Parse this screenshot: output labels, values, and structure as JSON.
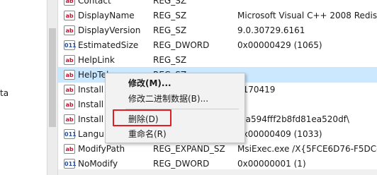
{
  "tree": {
    "partial_label": "ta"
  },
  "rows": [
    {
      "icon": "ab",
      "name": "Contact",
      "type": "REG_SZ",
      "data": ""
    },
    {
      "icon": "ab",
      "name": "DisplayName",
      "type": "REG_SZ",
      "data": "Microsoft Visual C++ 2008 Redis"
    },
    {
      "icon": "ab",
      "name": "DisplayVersion",
      "type": "REG_SZ",
      "data": "9.0.30729.6161"
    },
    {
      "icon": "011",
      "name": "EstimatedSize",
      "type": "REG_DWORD",
      "data": "0x00000429 (1065)"
    },
    {
      "icon": "ab",
      "name": "HelpLink",
      "type": "REG_SZ",
      "data": ""
    },
    {
      "icon": "ab",
      "name": "HelpTele",
      "type": "REG_SZ",
      "data": ""
    },
    {
      "icon": "ab",
      "name": "Install",
      "type": "",
      "data": "0170419"
    },
    {
      "icon": "ab",
      "name": "Install",
      "type": "",
      "data": ""
    },
    {
      "icon": "ab",
      "name": "Install",
      "type": "",
      "data": "\\8a594fff2b8fd81ea520df\\"
    },
    {
      "icon": "011",
      "name": "Langu",
      "type": "",
      "data": "0x00000409 (1033)"
    },
    {
      "icon": "ab",
      "name": "ModifyPath",
      "type": "REG_EXPAND_SZ",
      "data": "MsiExec.exe /X{5FCE6D76-F5DC-"
    },
    {
      "icon": "011",
      "name": "NoModify",
      "type": "REG_DWORD",
      "data": "0x00000001 (1)"
    }
  ],
  "context_menu": {
    "modify": "修改(M)...",
    "modify_binary": "修改二进制数据(B)...",
    "delete": "删除(D)",
    "rename": "重命名(R)"
  }
}
